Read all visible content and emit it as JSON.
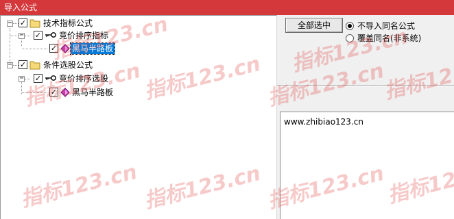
{
  "window": {
    "title": "导入公式"
  },
  "tree": {
    "nodes": [
      {
        "label": "技术指标公式",
        "checked": true,
        "expanded": true
      },
      {
        "label": "竞价排序指标",
        "checked": true,
        "expanded": true
      },
      {
        "label": "黑马半路板",
        "checked": true,
        "selected": true
      },
      {
        "label": "条件选股公式",
        "checked": true,
        "expanded": true
      },
      {
        "label": "竞价排序选股",
        "checked": true,
        "expanded": true
      },
      {
        "label": "黑马半路板",
        "checked": true,
        "selected": false
      }
    ]
  },
  "actions": {
    "select_all_label": "全部选中",
    "options": [
      {
        "label": "不导入同名公式",
        "selected": true
      },
      {
        "label": "覆盖同名(非系统)",
        "selected": false
      }
    ]
  },
  "info": {
    "text": "www.zhibiao123.cn"
  },
  "watermark": {
    "text": "指标123.cn",
    "accent_color": "#e85050"
  },
  "colors": {
    "titlebar": "#d4383b",
    "selection": "#0078d7"
  }
}
